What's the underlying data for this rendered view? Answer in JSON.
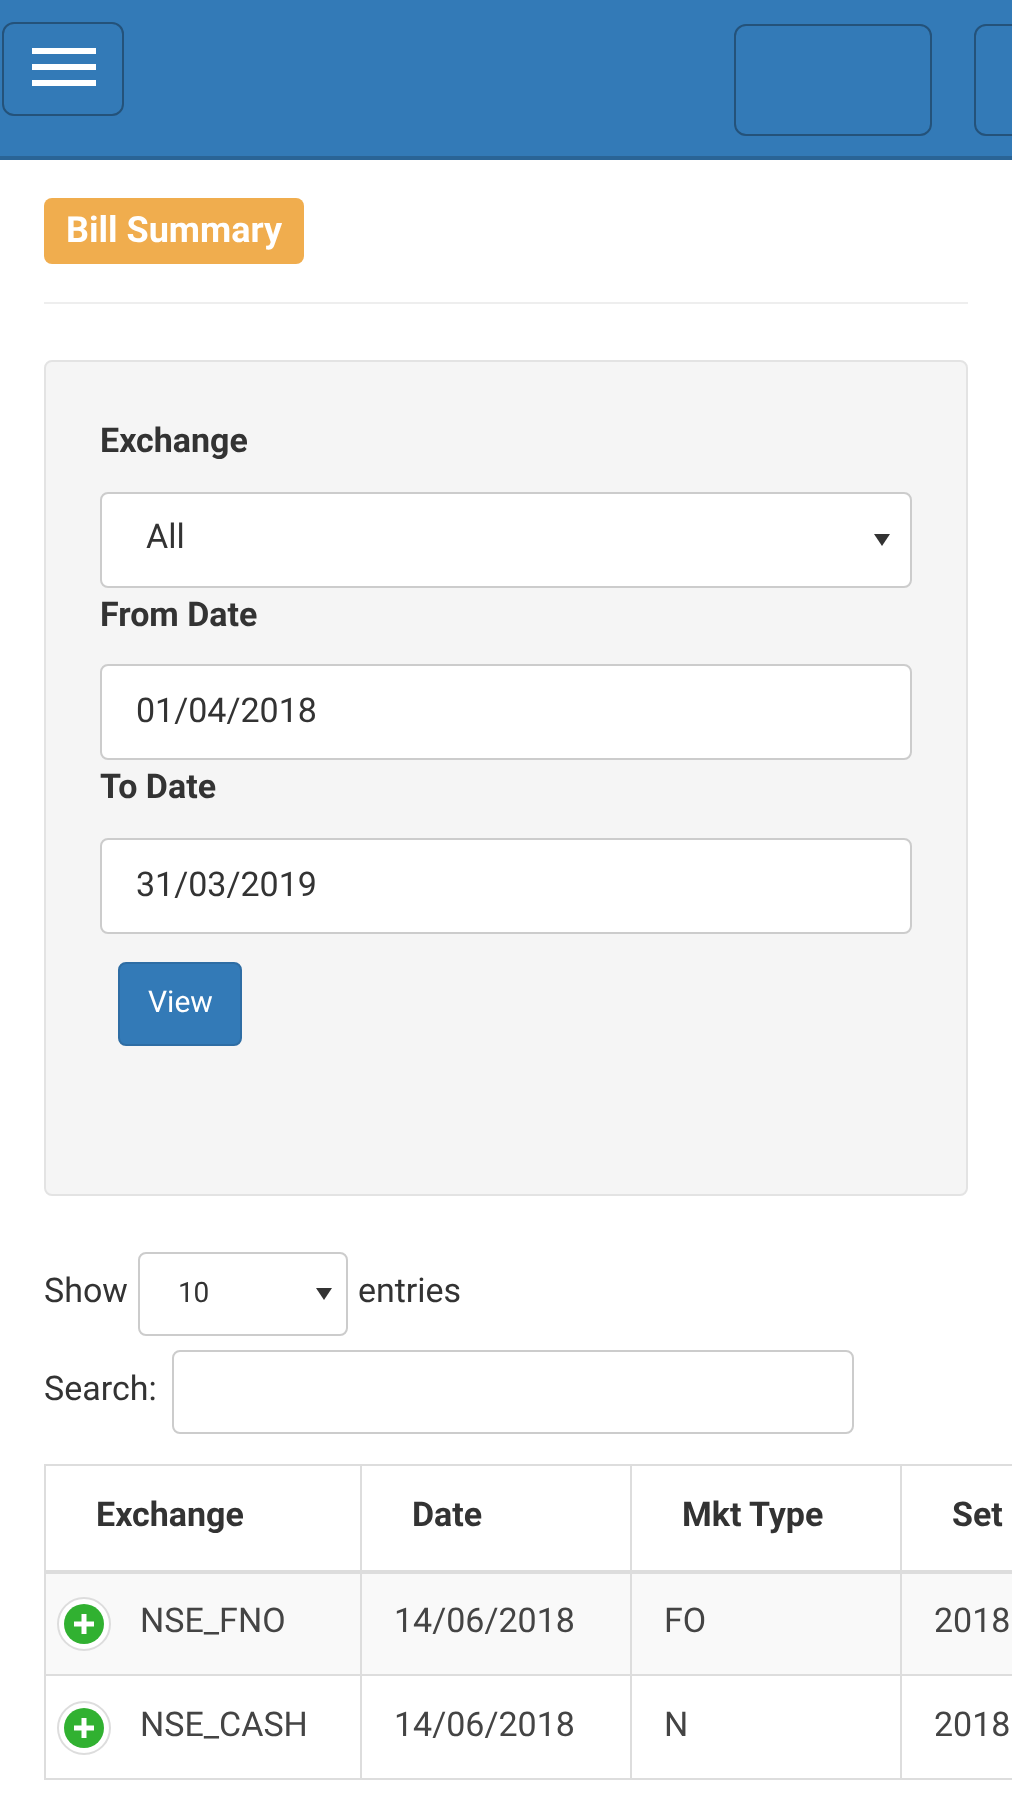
{
  "page_badge": "Bill Summary",
  "filter": {
    "exchange_label": "Exchange",
    "exchange_value": "All",
    "from_label": "From Date",
    "from_value": "01/04/2018",
    "to_label": "To Date",
    "to_value": "31/03/2019",
    "view_button": "View"
  },
  "length": {
    "show": "Show",
    "value": "10",
    "entries": "entries"
  },
  "search": {
    "label": "Search:"
  },
  "table": {
    "columns": [
      "Exchange",
      "Date",
      "Mkt Type",
      "Set"
    ],
    "rows": [
      {
        "cells": [
          "NSE_FNO",
          "14/06/2018",
          "FO",
          "2018"
        ]
      },
      {
        "cells": [
          "NSE_CASH",
          "14/06/2018",
          "N",
          "2018"
        ]
      }
    ]
  }
}
